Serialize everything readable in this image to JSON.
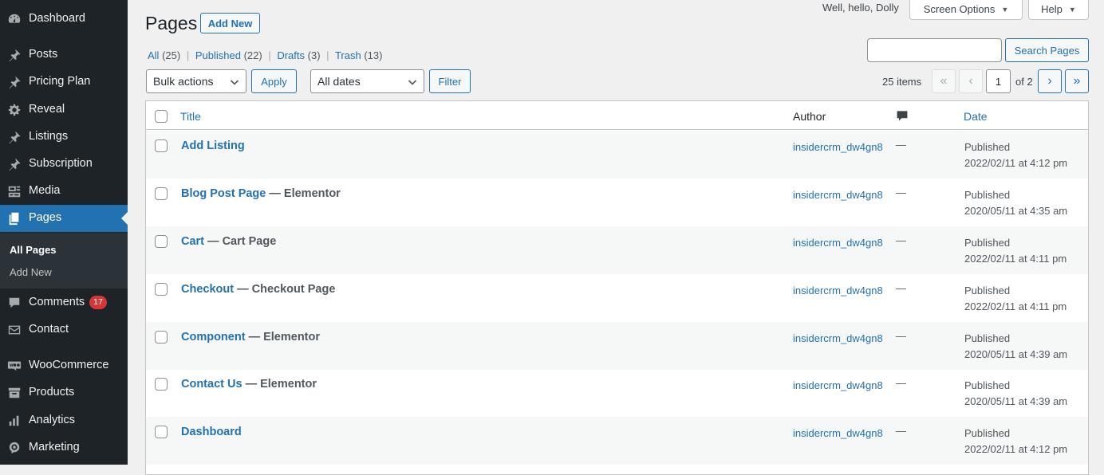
{
  "sidebar": {
    "items": [
      {
        "label": "Dashboard",
        "icon": "dashboard-icon"
      },
      {
        "label": "Posts",
        "icon": "pin-icon"
      },
      {
        "label": "Pricing Plan",
        "icon": "pin-icon"
      },
      {
        "label": "Reveal",
        "icon": "gear-icon"
      },
      {
        "label": "Listings",
        "icon": "pin-icon"
      },
      {
        "label": "Subscription",
        "icon": "pin-icon"
      },
      {
        "label": "Media",
        "icon": "media-icon"
      },
      {
        "label": "Pages",
        "icon": "pages-icon"
      },
      {
        "label": "Comments",
        "icon": "comment-icon",
        "badge": "17"
      },
      {
        "label": "Contact",
        "icon": "mail-icon"
      },
      {
        "label": "WooCommerce",
        "icon": "woo-icon"
      },
      {
        "label": "Products",
        "icon": "archive-icon"
      },
      {
        "label": "Analytics",
        "icon": "bar-chart-icon"
      },
      {
        "label": "Marketing",
        "icon": "megaphone-icon"
      }
    ],
    "submenu": [
      {
        "label": "All Pages",
        "current": true
      },
      {
        "label": "Add New",
        "current": false
      }
    ]
  },
  "header": {
    "title": "Pages",
    "add_new": "Add New",
    "greeting": "Well, hello, Dolly",
    "screen_options": "Screen Options",
    "help": "Help"
  },
  "views": [
    {
      "label": "All",
      "count": "(25)"
    },
    {
      "label": "Published",
      "count": "(22)"
    },
    {
      "label": "Drafts",
      "count": "(3)"
    },
    {
      "label": "Trash",
      "count": "(13)"
    }
  ],
  "search": {
    "placeholder": "",
    "button": "Search Pages"
  },
  "filters": {
    "bulk_actions": "Bulk actions",
    "apply": "Apply",
    "dates": "All dates",
    "filter": "Filter"
  },
  "pagination": {
    "items": "25 items",
    "first": "«",
    "prev": "‹",
    "current": "1",
    "of": "of 2",
    "next": "›",
    "last": "»"
  },
  "table": {
    "columns": {
      "title": "Title",
      "author": "Author",
      "comments_icon": "comment-icon",
      "date": "Date"
    },
    "rows": [
      {
        "title": "Add Listing",
        "state": "",
        "author": "insidercrm_dw4gn8",
        "comments": "—",
        "status": "Published",
        "date": "2022/02/11 at 4:12 pm"
      },
      {
        "title": "Blog Post Page",
        "state": " — Elementor",
        "author": "insidercrm_dw4gn8",
        "comments": "—",
        "status": "Published",
        "date": "2020/05/11 at 4:35 am"
      },
      {
        "title": "Cart",
        "state": " — Cart Page",
        "author": "insidercrm_dw4gn8",
        "comments": "—",
        "status": "Published",
        "date": "2022/02/11 at 4:11 pm"
      },
      {
        "title": "Checkout",
        "state": " — Checkout Page",
        "author": "insidercrm_dw4gn8",
        "comments": "—",
        "status": "Published",
        "date": "2022/02/11 at 4:11 pm"
      },
      {
        "title": "Component",
        "state": " — Elementor",
        "author": "insidercrm_dw4gn8",
        "comments": "—",
        "status": "Published",
        "date": "2020/05/11 at 4:39 am"
      },
      {
        "title": "Contact Us",
        "state": " — Elementor",
        "author": "insidercrm_dw4gn8",
        "comments": "—",
        "status": "Published",
        "date": "2020/05/11 at 4:39 am"
      },
      {
        "title": "Dashboard",
        "state": "",
        "author": "insidercrm_dw4gn8",
        "comments": "—",
        "status": "Published",
        "date": "2022/02/11 at 4:12 pm"
      }
    ]
  },
  "colors": {
    "sidebar_bg": "#1d2327",
    "accent": "#2271b1",
    "badge": "#d63638",
    "page_bg": "#f0f0f1"
  }
}
